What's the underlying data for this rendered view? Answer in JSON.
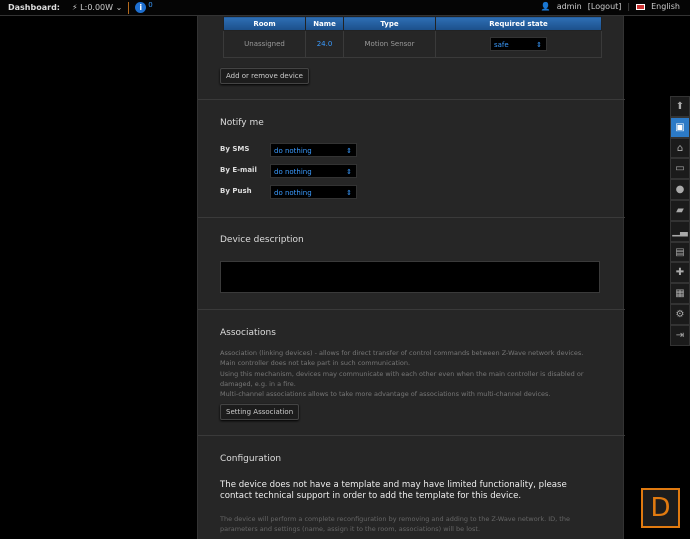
{
  "topbar": {
    "dashboard": "Dashboard:",
    "power": "L:0.00W",
    "info_count": "0",
    "user": "admin",
    "logout": "[Logout]",
    "language": "English"
  },
  "devices_table": {
    "headers": [
      "Room",
      "Name",
      "Type",
      "Required state"
    ],
    "rows": [
      {
        "room": "Unassigned",
        "name": "24.0",
        "type": "Motion Sensor",
        "state": "safe"
      }
    ],
    "add_button": "Add or remove device"
  },
  "notify": {
    "title": "Notify me",
    "items": [
      {
        "label": "By SMS",
        "value": "do nothing"
      },
      {
        "label": "By E-mail",
        "value": "do nothing"
      },
      {
        "label": "By Push",
        "value": "do nothing"
      }
    ]
  },
  "description": {
    "title": "Device description",
    "value": ""
  },
  "associations": {
    "title": "Associations",
    "lines": [
      "Association (linking devices) - allows for direct transfer of control commands between Z-Wave network devices.",
      "Main controller does not take part in such communication.",
      "Using this mechanism, devices may communicate with each other even when the main controller is disabled or damaged, e.g. in a fire.",
      "Multi-channel associations allows to take more advantage of associations with multi-channel devices."
    ],
    "button": "Setting Association"
  },
  "configuration": {
    "title": "Configuration",
    "warning": "The device does not have a template and may have limited functionality, please contact technical support in order to add the template for this device.",
    "note": "The device will perform a complete reconfiguration by removing and adding to the Z-Wave network. ID, the parameters and settings (name, assign it to the room, associations) will be lost."
  },
  "sidebar": [
    "arrow-up-icon",
    "save-icon",
    "home-icon",
    "monitor-icon",
    "bulb-icon",
    "ticket-icon",
    "chart-icon",
    "gift-icon",
    "plus-icon",
    "calendar-icon",
    "settings-icon",
    "exit-icon"
  ],
  "logo": "D"
}
